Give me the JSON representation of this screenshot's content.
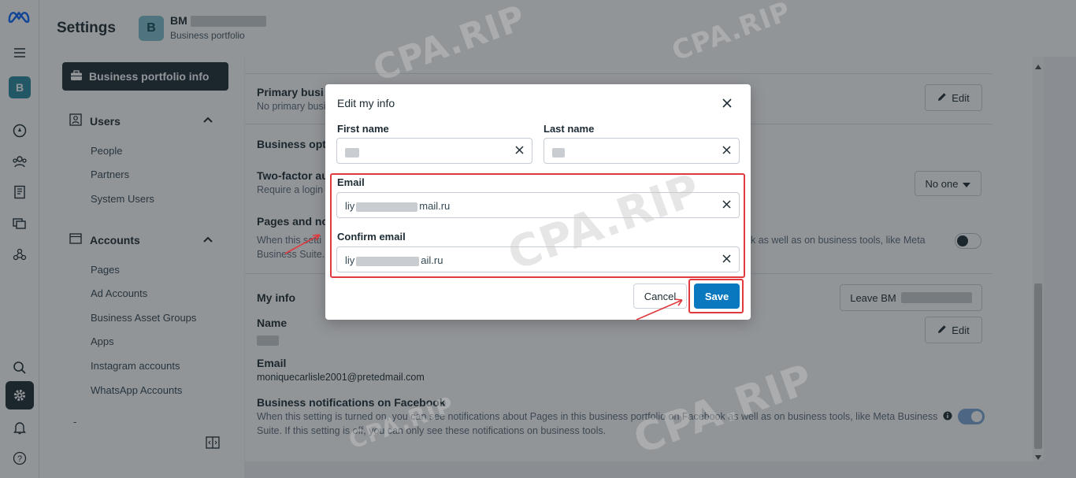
{
  "app": {
    "title": "Settings"
  },
  "business": {
    "avatar_letter": "B",
    "name": "BM",
    "subtitle": "Business portfolio"
  },
  "sidebar": {
    "active_item": "Business portfolio info",
    "sections": [
      {
        "label": "Users",
        "items": [
          "People",
          "Partners",
          "System Users"
        ]
      },
      {
        "label": "Accounts",
        "items": [
          "Pages",
          "Ad Accounts",
          "Business Asset Groups",
          "Apps",
          "Instagram accounts",
          "WhatsApp Accounts"
        ]
      }
    ],
    "trailing_dash": "-"
  },
  "main": {
    "primary": {
      "title": "Primary busi",
      "subtitle": "No primary busi",
      "edit_label": "Edit"
    },
    "options_title": "Business opt",
    "two_factor": {
      "title": "Two-factor au",
      "subtitle": "Require a login",
      "dropdown_value": "No one"
    },
    "pages_notif": {
      "title": "Pages and not",
      "line1": "When this setti",
      "line1_right": "k as well as on business tools, like Meta",
      "line2": "Business Suite. I"
    },
    "my_info": {
      "title": "My info",
      "leave_label": "Leave BM",
      "edit_label": "Edit",
      "name_label": "Name",
      "email_label": "Email",
      "email_value": "moniquecarlisle2001@pretedmail.com",
      "fb_notif_title": "Business notifications on Facebook",
      "fb_notif_line1": "When this setting is turned on, you can see notifications about Pages in this business portfolio on Facebook as well as on business tools, like Meta Business",
      "fb_notif_line2": "Suite. If this setting is off, you can only see these notifications on business tools."
    }
  },
  "modal": {
    "title": "Edit my info",
    "first_name_label": "First name",
    "last_name_label": "Last name",
    "email_label": "Email",
    "email_prefix": "liy",
    "email_suffix": "mail.ru",
    "confirm_label": "Confirm email",
    "confirm_prefix": "liy",
    "confirm_suffix": "ail.ru",
    "cancel_label": "Cancel",
    "save_label": "Save"
  },
  "watermark": "CPA.RIP",
  "colors": {
    "primary": "#0a78be",
    "dark": "#1c2b33",
    "highlight": "#e0393e",
    "brand_teal": "#2a89a0"
  },
  "icons": [
    "meta-logo-icon",
    "hamburger-icon",
    "compass-icon",
    "people-icon",
    "catalog-icon",
    "layers-icon",
    "network-icon",
    "search-icon",
    "gear-icon",
    "bell-icon",
    "help-icon",
    "briefcase-icon",
    "users-icon",
    "accounts-icon",
    "chevron-up-icon",
    "pencil-icon",
    "info-icon",
    "close-icon",
    "caret-down-icon",
    "panel-toggle-icon"
  ]
}
